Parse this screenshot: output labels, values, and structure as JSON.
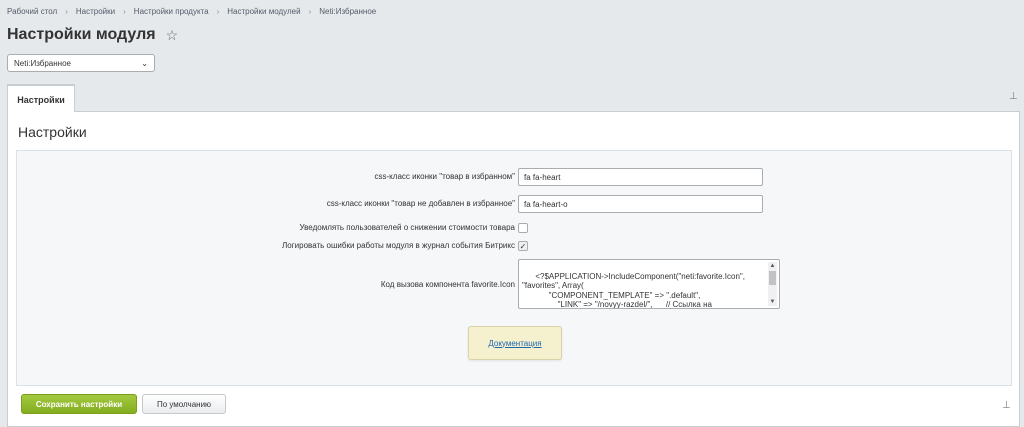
{
  "breadcrumb": [
    "Рабочий стол",
    "Настройки",
    "Настройки продукта",
    "Настройки модулей",
    "Neti:Избранное"
  ],
  "page_title": "Настройки модуля",
  "module_select": {
    "selected": "Neti:Избранное"
  },
  "tabs": [
    {
      "label": "Настройки"
    }
  ],
  "section_title": "Настройки",
  "fields": {
    "icon_in_fav": {
      "label": "css-класс иконки \"товар в избранном\"",
      "value": "fa fa-heart"
    },
    "icon_not_in_fav": {
      "label": "css-класс иконки \"товар не добавлен в избранное\"",
      "value": "fa fa-heart-o"
    },
    "notify_price": {
      "label": "Уведомлять пользователей о снижении стоимости товара",
      "checked": false
    },
    "log_errors": {
      "label": "Логировать ошибки работы модуля в журнал события Битрикс",
      "checked": true
    },
    "component_code": {
      "label": "Код вызова компонента favorite.Icon",
      "value": "<?$APPLICATION->IncludeComponent(\"neti:favorite.Icon\",\n\"favorites\", Array(\n            \"COMPONENT_TEMPLATE\" => \".default\",\n                \"LINK\" => \"/novyy-razdel/\",      // Ссылка на"
    }
  },
  "doc_button_label": "Документация",
  "buttons": {
    "save": "Сохранить настройки",
    "default": "По умолчанию"
  },
  "colors": {
    "save_green": "#8db52a",
    "doc_yellow": "#f5f1cf",
    "link_blue": "#2067b0"
  }
}
